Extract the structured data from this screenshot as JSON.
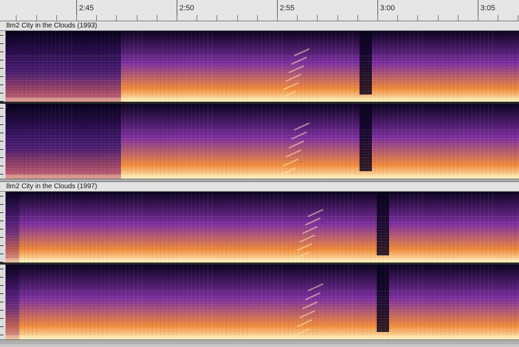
{
  "timeline": {
    "labels": [
      "2:45",
      "2:50",
      "2:55",
      "3:00",
      "3:05"
    ]
  },
  "tracks": [
    {
      "name": "8m2 City in the Clouds (1993)"
    },
    {
      "name": "8m2 City in the Clouds (1997)"
    }
  ],
  "colors": {
    "spectrogram_low": "#0c0420",
    "spectrogram_mid": "#7a2da0",
    "spectrogram_high": "#f08a3a",
    "spectrogram_peak": "#fff2c0"
  }
}
